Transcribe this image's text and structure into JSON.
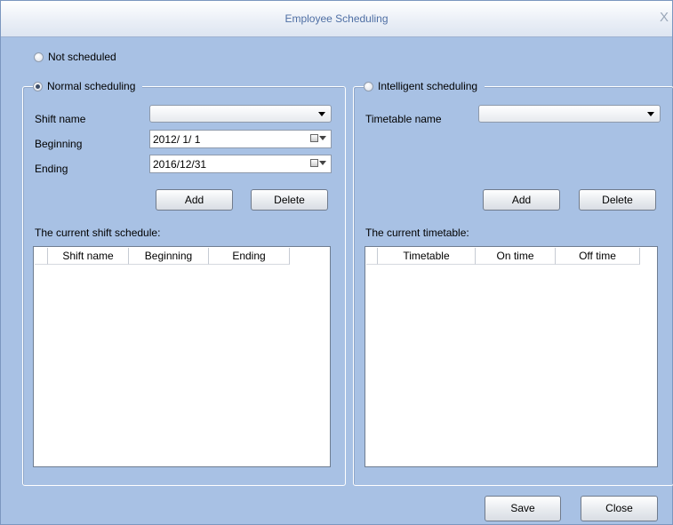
{
  "window": {
    "title": "Employee Scheduling",
    "close_glyph": "X"
  },
  "options": {
    "not_scheduled": "Not scheduled",
    "normal_scheduling": "Normal scheduling",
    "intelligent_scheduling": "Intelligent scheduling",
    "selected": "normal_scheduling"
  },
  "normal": {
    "shift_name_label": "Shift name",
    "shift_name_value": "",
    "beginning_label": "Beginning",
    "beginning_value": "2012/ 1/ 1",
    "ending_label": "Ending",
    "ending_value": "2016/12/31",
    "add_label": "Add",
    "delete_label": "Delete",
    "list_title": "The current shift schedule:",
    "columns": [
      "Shift name",
      "Beginning",
      "Ending"
    ]
  },
  "intelligent": {
    "timetable_name_label": "Timetable name",
    "timetable_name_value": "",
    "add_label": "Add",
    "delete_label": "Delete",
    "list_title": "The current timetable:",
    "columns": [
      "Timetable",
      "On time",
      "Off time"
    ]
  },
  "footer": {
    "save_label": "Save",
    "close_label": "Close"
  },
  "colors": {
    "window_bg": "#a8c1e4",
    "title_text": "#4f6fa4"
  }
}
